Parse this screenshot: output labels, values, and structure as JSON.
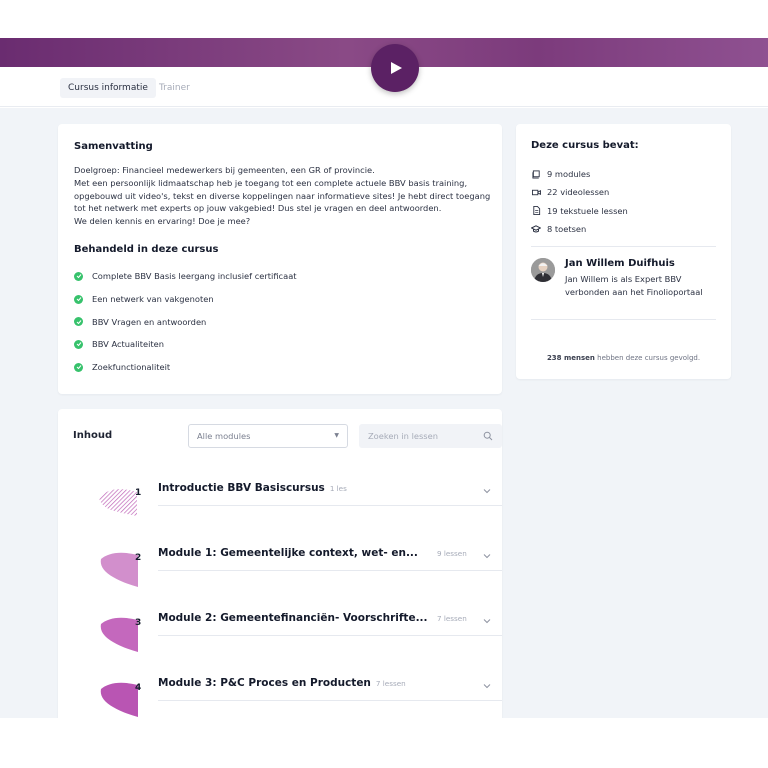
{
  "tabs": [
    {
      "label": "Cursus informatie",
      "active": true
    },
    {
      "label": "Trainer",
      "active": false
    }
  ],
  "summary": {
    "title": "Samenvatting",
    "paragraph_lines": [
      "Doelgroep: Financieel medewerkers bij gemeenten, een GR of provincie.",
      "Met een persoonlijk lidmaatschap heb je toegang tot een complete actuele BBV basis training,",
      "opgebouwd uit video's, tekst en diverse koppelingen naar informatieve sites! Je hebt direct toegang",
      "tot het netwerk met experts op jouw vakgebied! Dus stel je vragen en deel antwoorden.",
      "We delen kennis en ervaring! Doe je mee?"
    ],
    "covered_title": "Behandeld in deze cursus",
    "covered_items": [
      "Complete BBV Basis leergang inclusief certificaat",
      "Een netwerk van vakgenoten",
      "BBV Vragen en antwoorden",
      "BBV Actualiteiten",
      "Zoekfunctionaliteit"
    ]
  },
  "sidebar": {
    "title": "Deze cursus bevat:",
    "items": [
      {
        "icon": "modules-icon",
        "label": "9 modules"
      },
      {
        "icon": "video-icon",
        "label": "22 videolessen"
      },
      {
        "icon": "document-icon",
        "label": "19 tekstuele lessen"
      },
      {
        "icon": "graduation-cap-icon",
        "label": "8 toetsen"
      }
    ],
    "trainer": {
      "name": "Jan Willem Duifhuis",
      "bio": "Jan Willem is als Expert BBV verbonden aan het Finolioportaal"
    },
    "followers_count": "238 mensen",
    "followers_text": "hebben deze cursus gevolgd."
  },
  "content": {
    "title": "Inhoud",
    "filter_value": "Alle modules",
    "search_placeholder": "Zoeken in lessen",
    "modules": [
      {
        "number": "1",
        "title": "Introductie BBV Basiscursus",
        "count": "1 les"
      },
      {
        "number": "2",
        "title": "Module 1: Gemeentelijke context, wet- en...",
        "count": "9 lessen"
      },
      {
        "number": "3",
        "title": "Module 2: Gemeentefinanciën- Voorschrifte...",
        "count": "7 lessen"
      },
      {
        "number": "4",
        "title": "Module 3: P&C Proces en Producten",
        "count": "7 lessen"
      }
    ]
  },
  "colors": {
    "banner": "#7c3b7c",
    "play_button": "#5b2164",
    "check": "#37c26c",
    "module_shape": "#c067b9",
    "page_background": "#f1f4f8"
  }
}
